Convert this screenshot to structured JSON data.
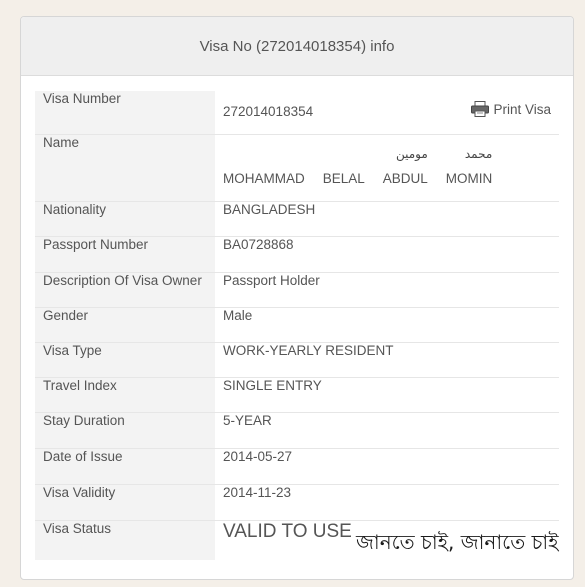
{
  "panel": {
    "title": "Visa No (272014018354) info"
  },
  "print": {
    "label": "Print Visa"
  },
  "rows": {
    "visa_number": {
      "label": "Visa Number",
      "value": "272014018354"
    },
    "name": {
      "label": "Name",
      "parts": [
        {
          "ar": "",
          "en": "MOHAMMAD"
        },
        {
          "ar": "",
          "en": "BELAL"
        },
        {
          "ar": "مومين",
          "en": "ABDUL"
        },
        {
          "ar": "محمد",
          "en": "MOMIN"
        }
      ]
    },
    "nationality": {
      "label": "Nationality",
      "value": "BANGLADESH"
    },
    "passport": {
      "label": "Passport Number",
      "value": "BA0728868"
    },
    "description": {
      "label": "Description Of Visa Owner",
      "value": "Passport Holder"
    },
    "gender": {
      "label": "Gender",
      "value": "Male"
    },
    "visa_type": {
      "label": "Visa Type",
      "value": "WORK-YEARLY RESIDENT"
    },
    "travel_index": {
      "label": "Travel Index",
      "value": "SINGLE ENTRY"
    },
    "stay_duration": {
      "label": "Stay Duration",
      "value": "5-YEAR"
    },
    "date_of_issue": {
      "label": "Date of Issue",
      "value": "2014-05-27"
    },
    "visa_validity": {
      "label": "Visa Validity",
      "value": "2014-11-23"
    },
    "visa_status": {
      "label": "Visa Status",
      "value": "VALID TO USE"
    }
  },
  "watermark": "জানতে চাই, জানাতে চাই",
  "colors": {
    "status": "#d31f1f",
    "label_bg": "#f3f3f3"
  },
  "icons": {
    "print": "printer-icon"
  }
}
